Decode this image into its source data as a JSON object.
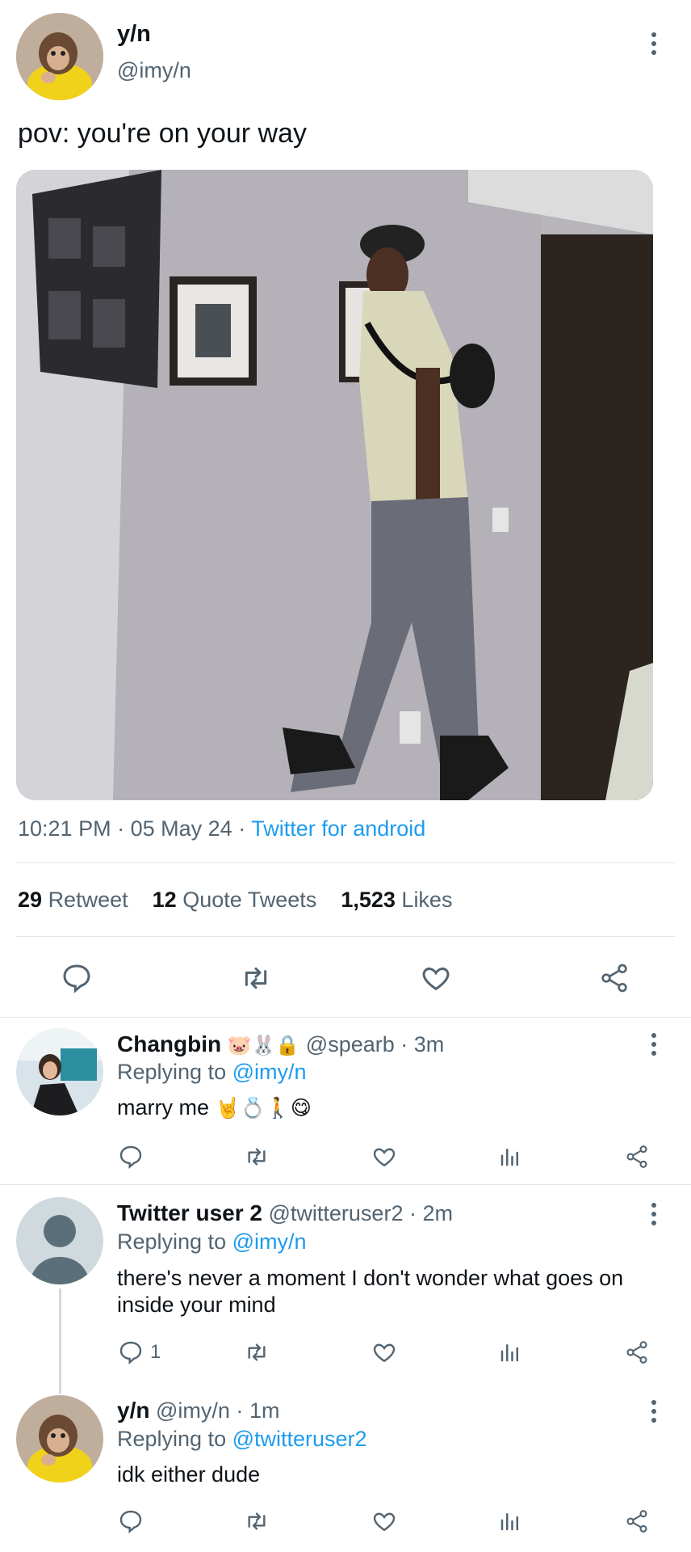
{
  "tweet": {
    "display_name": "y/n",
    "handle": "@imy/n",
    "text": "pov: you're on your way",
    "time": "10:21 PM",
    "sep1": "·",
    "date": "05 May 24",
    "sep2": "·",
    "client": "Twitter for android",
    "retweets_count": "29",
    "retweets_label": "Retweet",
    "quotes_count": "12",
    "quotes_label": "Quote Tweets",
    "likes_count": "1,523",
    "likes_label": "Likes"
  },
  "replies": [
    {
      "display_name": "Changbin",
      "emojis": "🐷🐰🔒",
      "handle": "@spearb",
      "sep": "·",
      "time": "3m",
      "replying_prefix": "Replying to",
      "replying_to": "@imy/n",
      "text": "marry me",
      "text_emojis": "🤘💍🚶😋",
      "reply_count": ""
    },
    {
      "display_name": "Twitter user 2",
      "handle": "@twitteruser2",
      "sep": "·",
      "time": "2m",
      "replying_prefix": "Replying to",
      "replying_to": "@imy/n",
      "text": "there's never a moment I don't wonder what goes on inside your mind",
      "reply_count": "1"
    },
    {
      "display_name": "y/n",
      "handle": "@imy/n",
      "sep": "·",
      "time": "1m",
      "replying_prefix": "Replying to",
      "replying_to": "@twitteruser2",
      "text": "idk either dude",
      "reply_count": ""
    }
  ],
  "colors": {
    "accent": "#1d9bf0",
    "muted": "#536471",
    "divider": "#e1e5e8"
  },
  "icons": [
    "more-icon",
    "reply-icon",
    "retweet-icon",
    "like-icon",
    "share-icon",
    "analytics-icon"
  ]
}
